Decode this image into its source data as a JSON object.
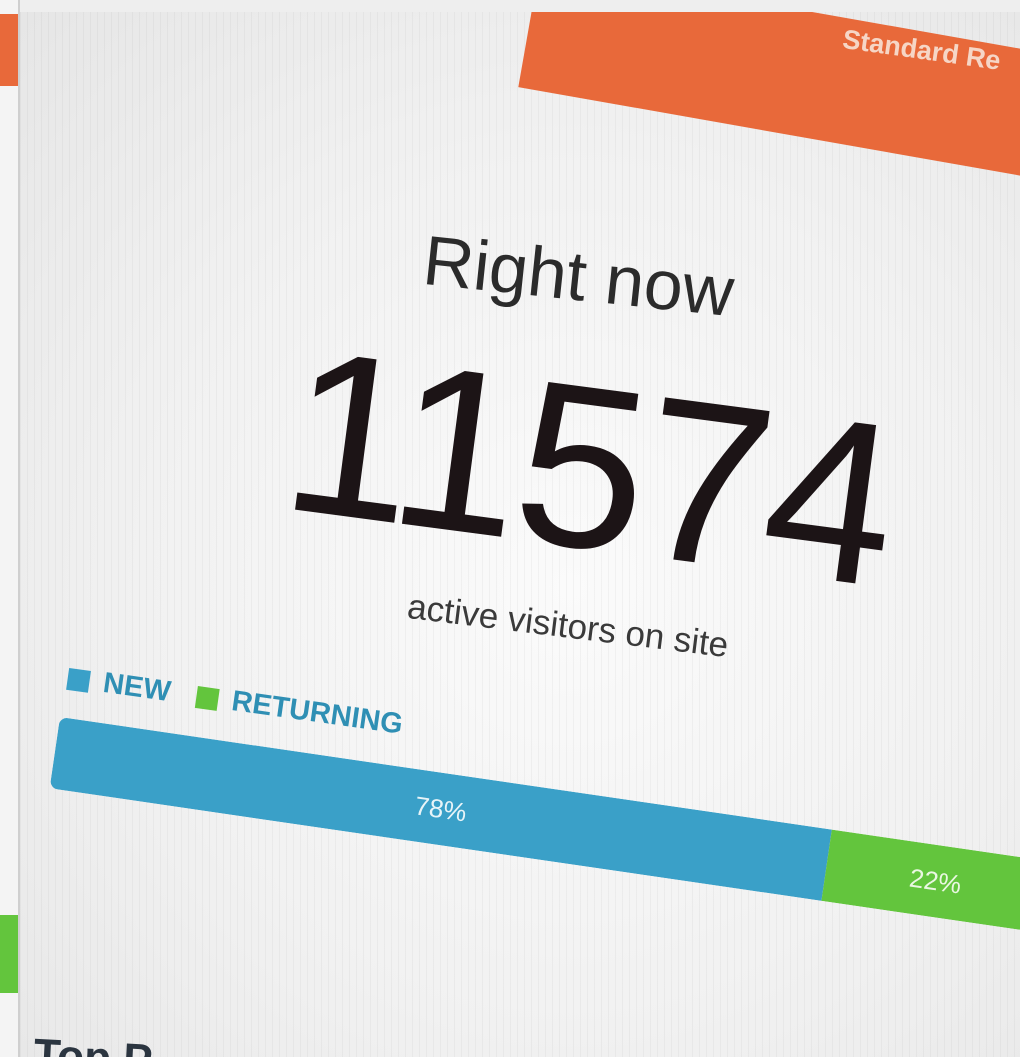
{
  "header": {
    "label": "Standard Re"
  },
  "realtime": {
    "title": "Right now",
    "active_count": "11574",
    "subtitle": "active visitors on site"
  },
  "legend": {
    "new_label": "NEW",
    "returning_label": "RETURNING"
  },
  "split": {
    "new_percent_label": "78%",
    "returning_percent_label": "22%",
    "new_fraction": 0.78,
    "returning_fraction": 0.22
  },
  "next_section": {
    "heading": "Top P"
  },
  "colors": {
    "header": "#e8693a",
    "new": "#3aa0c8",
    "returning": "#63c53d"
  }
}
